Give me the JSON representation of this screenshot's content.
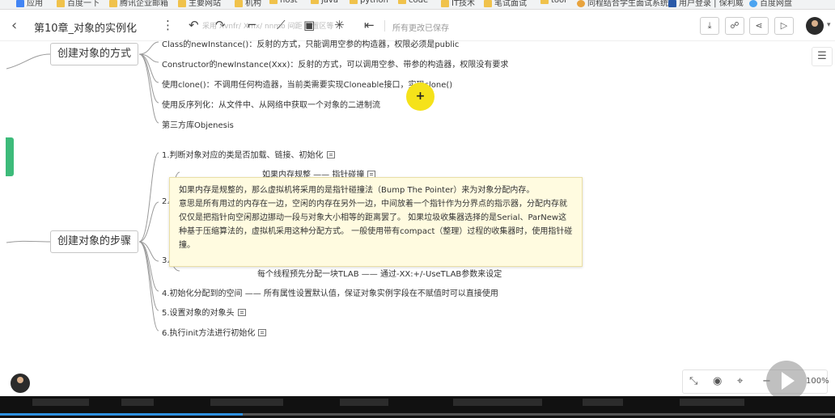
{
  "bookmarks": [
    {
      "label": "应用",
      "icon": "apps-icon"
    },
    {
      "label": "百度一下",
      "icon": "folder-icon"
    },
    {
      "label": "腾讯企业邮箱",
      "icon": "folder-icon"
    },
    {
      "label": "主要网站",
      "icon": "folder-icon"
    },
    {
      "label": "机构",
      "icon": "folder-icon"
    },
    {
      "label": "host",
      "icon": "folder-icon"
    },
    {
      "label": "java",
      "icon": "folder-icon"
    },
    {
      "label": "python",
      "icon": "folder-icon"
    },
    {
      "label": "code",
      "icon": "folder-icon"
    },
    {
      "label": "IT技术",
      "icon": "folder-icon"
    },
    {
      "label": "笔试面试",
      "icon": "folder-icon"
    },
    {
      "label": "tool",
      "icon": "folder-icon"
    },
    {
      "label": "同程结合学生面试系统",
      "icon": "site-icon"
    },
    {
      "label": "用户登录 | 保利威",
      "icon": "site-icon"
    },
    {
      "label": "百度网盘",
      "icon": "site-icon"
    }
  ],
  "toolbar": {
    "back_icon": "‹",
    "title": "第10章_对象的实例化",
    "save_status": "所有更改已保存",
    "faded_text": "采用 Xvnfr/ Xmx/ nnmo 间距 配置区等"
  },
  "mindmap": {
    "branch1": {
      "label": "创建对象的方式",
      "children": [
        "Class的newInstance()：反射的方式，只能调用空参的构造器，权限必须是public",
        "Constructor的newInstance(Xxx)：反射的方式，可以调用空参、带参的构造器，权限没有要求",
        "使用clone()：不调用任何构造器，当前类需要实现Cloneable接口，实现clone()",
        "使用反序列化：从文件中、从网络中获取一个对象的二进制流",
        "第三方库Objenesis"
      ]
    },
    "branch2": {
      "label": "创建对象的步骤",
      "step1": "1.判断对象对应的类是否加载、链接、初始化",
      "step2_prefix": "2.",
      "step2_sub": "如果内存规整 —— 指针碰撞",
      "step3_prefix": "3.",
      "step3_sub": "每个线程预先分配一块TLAB —— 通过-XX:+/-UseTLAB参数来设定",
      "step4": "4.初始化分配到的空间 —— 所有属性设置默认值，保证对象实例字段在不赋值时可以直接使用",
      "step5": "5.设置对象的对象头",
      "step6": "6.执行init方法进行初始化"
    }
  },
  "tooltip": {
    "p1": "如果内存是规整的，那么虚拟机将采用的是指针碰撞法（Bump The Pointer）来为对象分配内存。",
    "p2": "意思是所有用过的内存在一边，空闲的内存在另外一边，中间放着一个指针作为分界点的指示器，分配内存就仅仅是把指针向空闲那边挪动一段与对象大小相等的距离罢了。 如果垃圾收集器选择的是Serial、ParNew这种基于压缩算法的，虚拟机采用这种分配方式。 一般使用带有compact（整理）过程的收集器时，使用指针碰撞。"
  },
  "cursor_symbol": "+",
  "zoom": {
    "value": "100%"
  },
  "colors": {
    "accent": "#3dbb7a",
    "highlight": "#f5e21a",
    "tooltip_bg": "#fffbe0"
  }
}
